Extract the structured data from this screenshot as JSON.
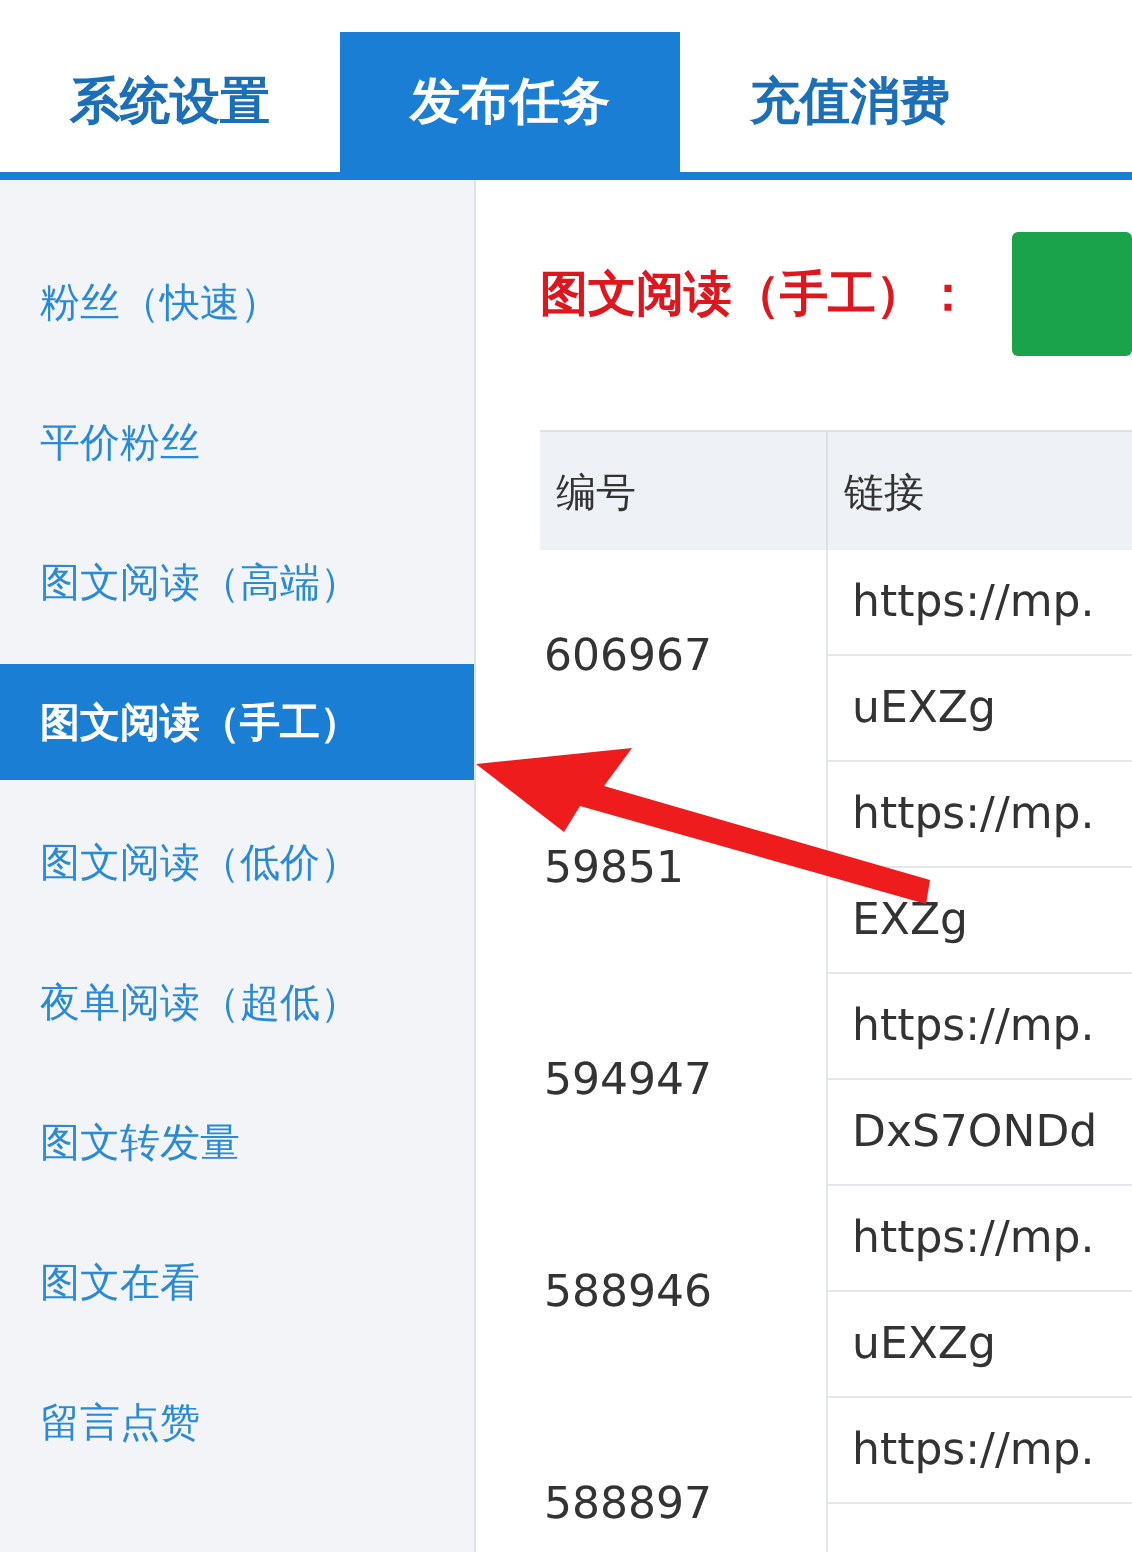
{
  "tabs": [
    {
      "label": "系统设置",
      "selected": false
    },
    {
      "label": "发布任务",
      "selected": true
    },
    {
      "label": "充值消费",
      "selected": false
    }
  ],
  "sidebar": {
    "items": [
      {
        "label": "粉丝（快速）",
        "selected": false
      },
      {
        "label": "平价粉丝",
        "selected": false
      },
      {
        "label": "图文阅读（高端）",
        "selected": false
      },
      {
        "label": "图文阅读（手工）",
        "selected": true
      },
      {
        "label": "图文阅读（低价）",
        "selected": false
      },
      {
        "label": "夜单阅读（超低）",
        "selected": false
      },
      {
        "label": "图文转发量",
        "selected": false
      },
      {
        "label": "图文在看",
        "selected": false
      },
      {
        "label": "留言点赞",
        "selected": false
      }
    ]
  },
  "page_title": "图文阅读（手工）：",
  "table": {
    "columns": [
      "编号",
      "链接"
    ],
    "rows": [
      {
        "id": "606967",
        "link_lines": [
          "https://mp.",
          "uEXZg"
        ]
      },
      {
        "id": "59851",
        "link_lines": [
          "https://mp.",
          "EXZg"
        ]
      },
      {
        "id": "594947",
        "link_lines": [
          "https://mp.",
          "DxS7ONDd"
        ]
      },
      {
        "id": "588946",
        "link_lines": [
          "https://mp.",
          "uEXZg"
        ]
      },
      {
        "id": "588897",
        "link_lines": [
          "https://mp."
        ]
      }
    ]
  }
}
